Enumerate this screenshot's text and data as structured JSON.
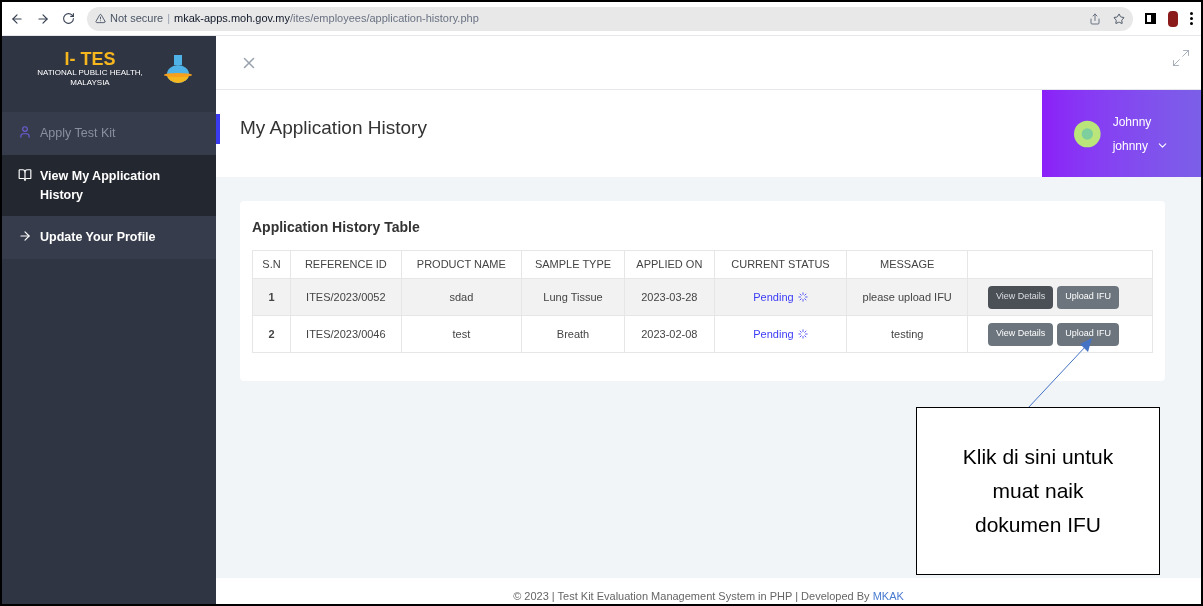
{
  "browser": {
    "security": "Not secure",
    "separator": "|",
    "url_host": "mkak-apps.moh.gov.my",
    "url_path": "/ites/employees/application-history.php"
  },
  "logo": {
    "title": "I- TES",
    "subtitle": "NATIONAL PUBLIC HEALTH, MALAYSIA"
  },
  "sidebar": {
    "items": [
      {
        "label": "Apply Test Kit",
        "kind": "user",
        "selected": false,
        "muted": true
      },
      {
        "label": "View My Application History",
        "kind": "book",
        "selected": true,
        "muted": false
      },
      {
        "label": "Update Your Profile",
        "kind": "arrow",
        "selected": false,
        "muted": false
      }
    ]
  },
  "page_title": "My Application History",
  "user": {
    "name": "Johnny",
    "username": "johnny"
  },
  "table": {
    "title": "Application History Table",
    "columns": [
      "S.N",
      "REFERENCE ID",
      "PRODUCT NAME",
      "SAMPLE TYPE",
      "APPLIED ON",
      "CURRENT STATUS",
      "MESSAGE"
    ],
    "rows": [
      {
        "sn": "1",
        "reference": "ITES/2023/0052",
        "product": "sdad",
        "sample": "Lung Tissue",
        "applied": "2023-03-28",
        "status": "Pending",
        "message": "please upload IFU",
        "buttons": [
          {
            "label": "View Details",
            "hovered": true
          },
          {
            "label": "Upload IFU",
            "hovered": false
          }
        ]
      },
      {
        "sn": "2",
        "reference": "ITES/2023/0046",
        "product": "test",
        "sample": "Breath",
        "applied": "2023-02-08",
        "status": "Pending",
        "message": "testing",
        "buttons": [
          {
            "label": "View Details",
            "hovered": false
          },
          {
            "label": "Upload IFU",
            "hovered": false
          }
        ]
      }
    ]
  },
  "callout": "Klik di sini untuk muat naik dokumen IFU",
  "footer": {
    "text": "© 2023 | Test Kit Evaluation Management System in PHP | Developed By",
    "link": "MKAK"
  }
}
